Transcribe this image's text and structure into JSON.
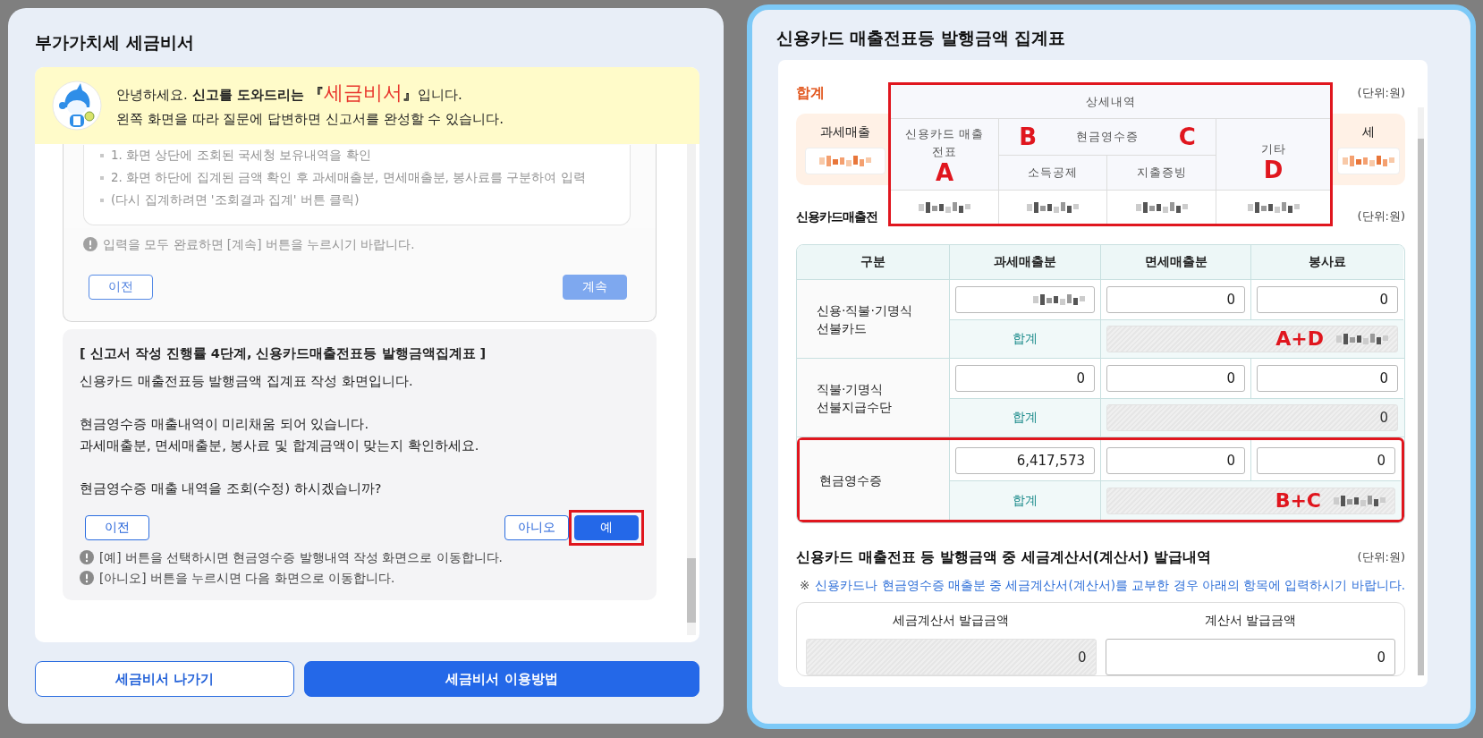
{
  "assistant": {
    "title": "부가가치세 세금비서",
    "banner": {
      "line1": [
        {
          "kind": "plain",
          "text": "안녕하세요. "
        },
        {
          "kind": "bold",
          "text": "신고를 도와드리는 "
        },
        {
          "kind": "bracket",
          "text": "『"
        },
        {
          "kind": "brand",
          "text": "세금비서"
        },
        {
          "kind": "bracket",
          "text": "』"
        },
        {
          "kind": "plain",
          "text": "입니다."
        }
      ],
      "line2": "왼쪽 화면을 따라 질문에 답변하면 신고서를 완성할 수 있습니다."
    },
    "previous_step": {
      "disabled": true,
      "bullets": [
        "1. 화면 상단에 조회된 국세청 보유내역을 확인",
        "2. 화면 하단에 집계된 금액 확인 후 과세매출분, 면세매출분, 봉사료를 구분하여 입력",
        "(다시 집계하려면 '조회결과 집계' 버튼 클릭)"
      ],
      "notice": "입력을 모두 완료하면 [계속] 버튼을 누르시기 바랍니다.",
      "buttons": [
        {
          "label": "이전",
          "kind": "outline"
        },
        {
          "label": "계속",
          "kind": "primary"
        }
      ]
    },
    "current_step": {
      "heading": "[ 신고서 작성 진행률 4단계, 신용카드매출전표등 발행금액집계표 ]",
      "paragraphs": [
        [
          "신용카드 매출전표등 발행금액 집계표 작성 화면입니다."
        ],
        [
          "현금영수증 매출내역이 미리채움 되어 있습니다.",
          "과세매출분, 면세매출분, 봉사료 및 합계금액이 맞는지 확인하세요."
        ],
        [
          "현금영수증 매출 내역을 조회(수정) 하시겠습니까?"
        ]
      ],
      "buttons": [
        {
          "label": "이전",
          "kind": "outline",
          "highlighted": false
        },
        {
          "label": "아니오",
          "kind": "outline",
          "highlighted": false
        },
        {
          "label": "예",
          "kind": "primary",
          "highlighted": true
        }
      ],
      "notes": [
        "[예] 버튼을 선택하시면 현금영수증 발행내역 작성 화면으로 이동합니다.",
        "[아니오] 버튼을 누르시면 다음 화면으로 이동합니다."
      ]
    },
    "footer_buttons": [
      {
        "label": "세금비서 나가기",
        "kind": "outline"
      },
      {
        "label": "세금비서 이용방법",
        "kind": "primary"
      }
    ]
  },
  "form": {
    "title": "신용카드 매출전표등 발행금액 집계표",
    "total": {
      "title": "합계",
      "unit": "(단위:원)",
      "items": [
        {
          "label": "과세매출"
        },
        {
          "label": "세"
        }
      ]
    },
    "annotation": {
      "title": "상세내역",
      "card_column": {
        "label": "신용카드 매출전표",
        "marker": "A"
      },
      "cash_group": {
        "label": "현금영수증",
        "markers": [
          "B",
          "C"
        ],
        "columns": [
          "소득공제",
          "지출증빙"
        ]
      },
      "other_column": {
        "label": "기타",
        "marker": "D"
      }
    },
    "card_section": {
      "title": "신용카드매출전",
      "unit": "(단위:원)",
      "columns": [
        "구분",
        "과세매출분",
        "면세매출분",
        "봉사료"
      ],
      "groups": [
        {
          "label": "신용·직불·기명식\n선불카드",
          "highlighted": false,
          "inputs": [
            {
              "kind": "redacted"
            },
            {
              "kind": "text",
              "value": "0"
            },
            {
              "kind": "text",
              "value": "0"
            }
          ],
          "total": {
            "label": "합계",
            "kind": "redacted",
            "marker": "A+D"
          }
        },
        {
          "label": "직불·기명식\n선불지급수단",
          "highlighted": false,
          "inputs": [
            {
              "kind": "text",
              "value": "0"
            },
            {
              "kind": "text",
              "value": "0"
            },
            {
              "kind": "text",
              "value": "0"
            }
          ],
          "total": {
            "label": "합계",
            "kind": "text",
            "value": "0"
          }
        },
        {
          "label": "현금영수증",
          "highlighted": true,
          "inputs": [
            {
              "kind": "text",
              "value": "6,417,573"
            },
            {
              "kind": "text",
              "value": "0"
            },
            {
              "kind": "text",
              "value": "0"
            }
          ],
          "total": {
            "label": "합계",
            "kind": "redacted",
            "marker": "B+C"
          }
        }
      ]
    },
    "issuance": {
      "title": "신용카드 매출전표 등 발행금액 중 세금계산서(계산서) 발급내역",
      "unit": "(단위:원)",
      "note_mark": "※",
      "note": "신용카드나 현금영수증 매출분 중 세금계산서(계산서)를 교부한 경우 아래의 항목에 입력하시기 바랍니다.",
      "fields": [
        {
          "label": "세금계산서 발급금액",
          "value": "0",
          "readonly": true
        },
        {
          "label": "계산서 발급금액",
          "value": "0",
          "readonly": false
        }
      ]
    }
  }
}
